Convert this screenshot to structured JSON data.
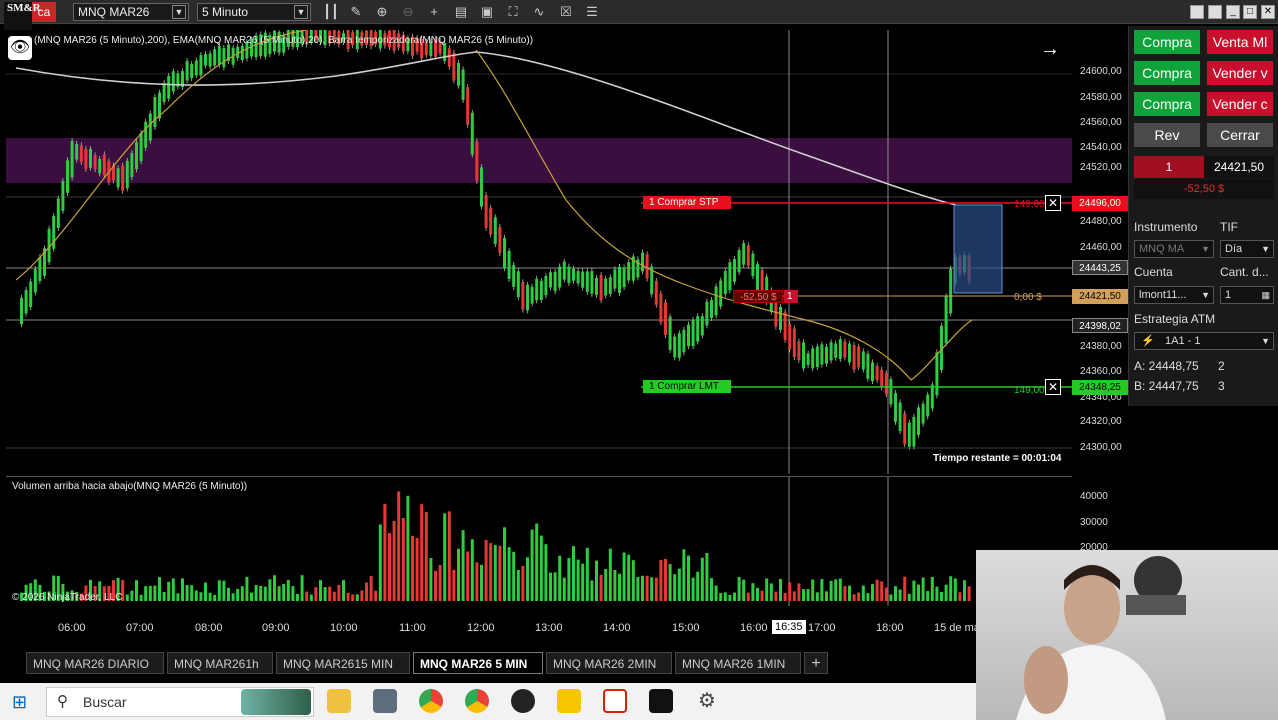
{
  "toolbar": {
    "logo": "SM&R",
    "logo_red": "ca",
    "instrument": "MNQ MAR26",
    "interval": "5 Minuto"
  },
  "chart": {
    "indicator_title": "(MNQ MAR26 (5 Minuto),200), EMA(MNQ MAR26 (5 Minuto),20), Barra temporizadora(MNQ MAR26 (5 Minuto))",
    "price_labels": [
      "24600,00",
      "24580,00",
      "24560,00",
      "24540,00",
      "24520,00",
      "24480,00",
      "24460,00",
      "24380,00",
      "24360,00",
      "24340,00",
      "24320,00",
      "24300,00"
    ],
    "tags": {
      "stop": "24496,00",
      "top_grey": "24443,25",
      "current": "24421,50",
      "mid_grey": "24398,02",
      "limit": "24348,25"
    },
    "orders": {
      "stop_label": "1  Comprar STP",
      "limit_label": "1  Comprar LMT",
      "pnl_label": "-52,50 $",
      "pnl_qty": "1",
      "right_pnl_top": "149,00",
      "right_pnl_mid": "0,00 $",
      "right_pnl_bot": "149,00"
    },
    "timer": "Tiempo restante = 00:01:04",
    "cursor_time": "16:35",
    "copyright": "© 2026 NinjaTrader, LLC",
    "time_labels": [
      "06:00",
      "07:00",
      "08:00",
      "09:00",
      "10:00",
      "11:00",
      "12:00",
      "13:00",
      "14:00",
      "15:00",
      "16:00",
      "17:00",
      "18:00",
      "15 de ma"
    ],
    "colors": {
      "up": "#2ecc40",
      "down": "#e53935",
      "ema200": "#cfcfcf",
      "ema20": "#c9a03a",
      "band": "#3a0f3f",
      "stop": "#e8101e",
      "limit": "#22cc22",
      "current": "#d2a05a"
    }
  },
  "volume": {
    "title": "Volumen arriba hacia abajo(MNQ MAR26 (5 Minuto))",
    "axis_labels": [
      "40000",
      "30000",
      "20000"
    ]
  },
  "panel": {
    "buy_mkt": "Compra",
    "sell_mkt": "Venta Ml",
    "buy2": "Compra",
    "sell2": "Vender v",
    "buy3": "Compra",
    "sell3": "Vender c",
    "rev": "Rev",
    "close": "Cerrar",
    "position_qty": "1",
    "position_price": "24421,50",
    "position_pnl": "-52,50 $",
    "instrument_label": "Instrumento",
    "tif_label": "TIF",
    "instrument_value": "MNQ MA",
    "tif_value": "Día",
    "account_label": "Cuenta",
    "qty_label": "Cant. d...",
    "account_value": "lmont11...",
    "qty_value": "1",
    "atm_label": "Estrategia ATM",
    "atm_value": "1A1 - 1",
    "ask": "A:  24448,75",
    "ask_size": "2",
    "bid": "B:  24447,75",
    "bid_size": "3"
  },
  "tabs": [
    "MNQ MAR26 DIARIO",
    "MNQ MAR261h",
    "MNQ MAR2615 MIN",
    "MNQ MAR26 5 MIN",
    "MNQ MAR26 2MIN",
    "MNQ MAR26 1MIN"
  ],
  "taskbar": {
    "search_placeholder": "Buscar"
  }
}
